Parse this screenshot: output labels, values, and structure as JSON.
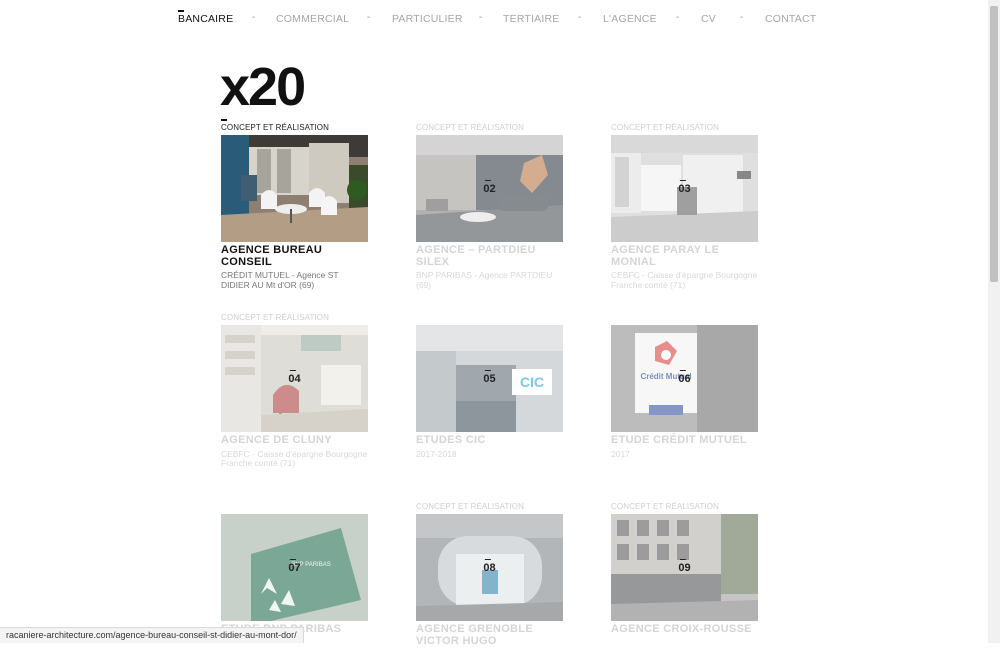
{
  "nav": {
    "items": [
      {
        "label": "BANCAIRE",
        "active": true
      },
      {
        "label": "COMMERCIAL",
        "active": false
      },
      {
        "label": "PARTICULIER",
        "active": false
      },
      {
        "label": "TERTIAIRE",
        "active": false
      },
      {
        "label": "L'AGENCE",
        "active": false
      },
      {
        "label": "CV",
        "active": false
      },
      {
        "label": "CONTACT",
        "active": false
      }
    ],
    "separator": "-"
  },
  "count": "x20",
  "projects": [
    {
      "num": "01",
      "tag": "CONCEPT ET RÉALISATION",
      "title": "AGENCE BUREAU CONSEIL",
      "subtitle": "CRÉDIT MUTUEL - Agence ST DIDIER AU Mt d'OR (69)"
    },
    {
      "num": "02",
      "tag": "CONCEPT ET RÉALISATION",
      "title": "AGENCE – PARTDIEU SILEX",
      "subtitle": "BNP PARIBAS - Agence PARTDIEU (69)"
    },
    {
      "num": "03",
      "tag": "CONCEPT ET RÉALISATION",
      "title": "AGENCE PARAY LE MONIAL",
      "subtitle": "CEBFC - Caisse d'épargne Bourgogne Franche comté (71)"
    },
    {
      "num": "04",
      "tag": "CONCEPT ET RÉALISATION",
      "title": "AGENCE DE CLUNY",
      "subtitle": "CEBFC - Caisse d'épargne Bourgogne Franche comté (71)"
    },
    {
      "num": "05",
      "tag": "",
      "title": "ETUDES CIC",
      "subtitle": "2017-2018"
    },
    {
      "num": "06",
      "tag": "",
      "title": "ETUDE CRÉDIT MUTUEL",
      "subtitle": "2017"
    },
    {
      "num": "07",
      "tag": "",
      "title": "ETUDE BNP PARIBAS",
      "subtitle": ""
    },
    {
      "num": "08",
      "tag": "CONCEPT ET RÉALISATION",
      "title": "AGENCE GRENOBLE VICTOR HUGO",
      "subtitle": ""
    },
    {
      "num": "09",
      "tag": "CONCEPT ET RÉALISATION",
      "title": "AGENCE CROIX-ROUSSE",
      "subtitle": ""
    }
  ],
  "image_labels": {
    "cic": "CIC",
    "credit_mutuel": "Crédit Mutuel",
    "bnp": "BNP PARIBAS"
  },
  "status_url": "racaniere-architecture.com/agence-bureau-conseil-st-didier-au-mont-dor/"
}
